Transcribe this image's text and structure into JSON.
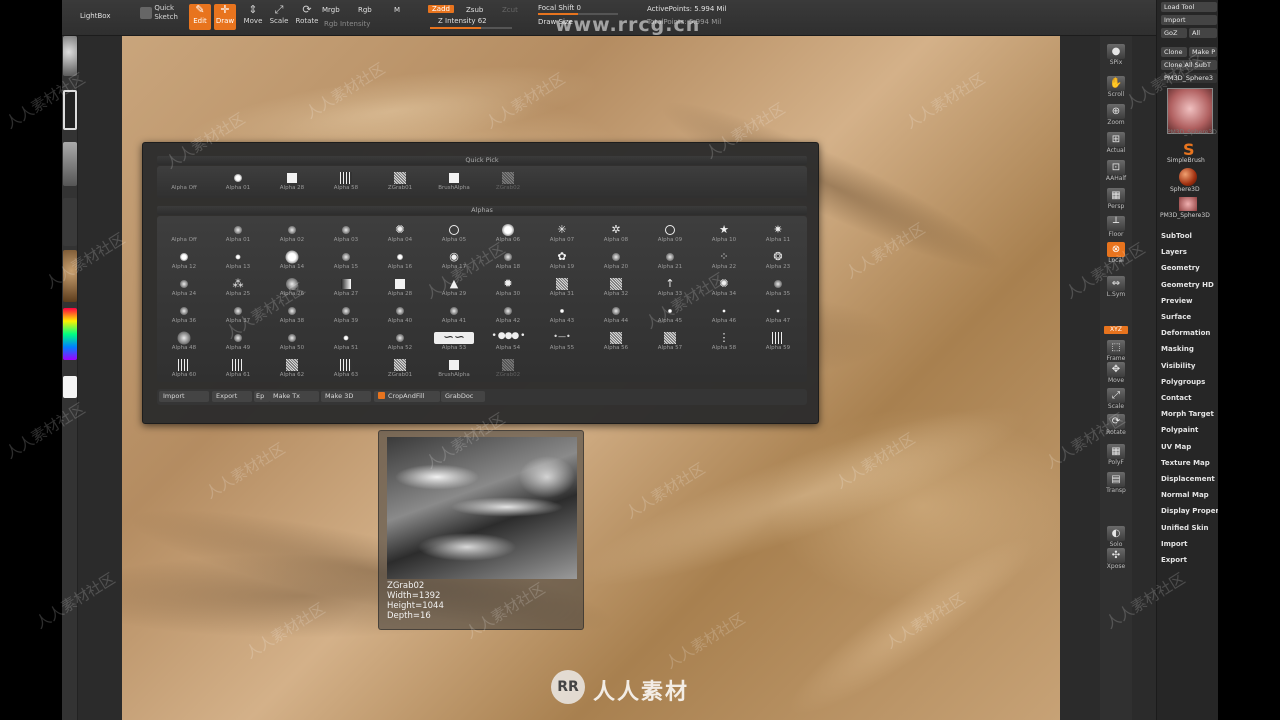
{
  "toolbar": {
    "lightbox": "LightBox",
    "quick_sketch": "Quick\nSketch",
    "edit": "Edit",
    "draw": "Draw",
    "move": "Move",
    "scale": "Scale",
    "rotate": "Rotate",
    "mrgb": "Mrgb",
    "rgb": "Rgb",
    "m": "M",
    "rgb_intensity": "Rgb Intensity",
    "zadd": "Zadd",
    "zsub": "Zsub",
    "zcut": "Zcut",
    "z_intensity": "Z Intensity 62",
    "focal_shift": "Focal Shift 0",
    "draw_size": "Draw Size",
    "active_points": "ActivePoints: 5.994 Mil",
    "total_points": "TotalPoints: 5.994 Mil"
  },
  "right_shelf": [
    "SPix",
    "Scroll",
    "Zoom",
    "Actual",
    "AAHalf",
    "Persp",
    "Floor",
    "Local",
    "L.Sym",
    "Frame",
    "Move",
    "Scale",
    "Rotate",
    "PolyF",
    "Transp",
    "Solo",
    "Xpose"
  ],
  "right_shelf_badge": "XYZ",
  "tool_palette": {
    "buttons": [
      "Load Tool",
      "Import",
      "GoZ",
      "All",
      "Clone",
      "Make P",
      "Clone All SubT",
      "PM3D_Sphere3"
    ],
    "thumb_labels": [
      "PM3D_Sphere3D",
      "SimpleBrush",
      "Sphere3D",
      "PM3D_Sphere3D"
    ],
    "menu": [
      "SubTool",
      "Layers",
      "Geometry",
      "Geometry HD",
      "Preview",
      "Surface",
      "Deformation",
      "Masking",
      "Visibility",
      "Polygroups",
      "Contact",
      "Morph Target",
      "Polypaint",
      "UV Map",
      "Texture Map",
      "Displacement",
      "Normal Map",
      "Display Proper",
      "Unified Skin",
      "Import",
      "Export"
    ]
  },
  "alpha_popup": {
    "quick_pick_title": "Quick Pick",
    "alphas_title": "Alphas",
    "quick_pick": [
      {
        "label": "Alpha Off",
        "kind": "none"
      },
      {
        "label": "Alpha 01",
        "kind": "dot"
      },
      {
        "label": "Alpha 28",
        "kind": "square"
      },
      {
        "label": "Alpha 58",
        "kind": "bars"
      },
      {
        "label": "ZGrab01",
        "kind": "noise"
      },
      {
        "label": "BrushAlpha",
        "kind": "square"
      },
      {
        "label": "ZGrab02",
        "kind": "noise",
        "dim": true
      }
    ],
    "alphas": [
      {
        "label": "Alpha Off",
        "kind": "none"
      },
      {
        "label": "Alpha 01",
        "kind": "soft"
      },
      {
        "label": "Alpha 02",
        "kind": "soft"
      },
      {
        "label": "Alpha 03",
        "kind": "soft"
      },
      {
        "label": "Alpha 04",
        "kind": "glyph",
        "glyph": "✺"
      },
      {
        "label": "Alpha 05",
        "kind": "ring"
      },
      {
        "label": "Alpha 06",
        "kind": "dot",
        "size": 12
      },
      {
        "label": "Alpha 07",
        "kind": "glyph",
        "glyph": "✳"
      },
      {
        "label": "Alpha 08",
        "kind": "glyph",
        "glyph": "✲"
      },
      {
        "label": "Alpha 09",
        "kind": "ring"
      },
      {
        "label": "Alpha 10",
        "kind": "glyph",
        "glyph": "★"
      },
      {
        "label": "Alpha 11",
        "kind": "glyph",
        "glyph": "✷"
      },
      {
        "label": "Alpha 12",
        "kind": "dot"
      },
      {
        "label": "Alpha 13",
        "kind": "dot",
        "size": 5
      },
      {
        "label": "Alpha 14",
        "kind": "dot",
        "size": 13
      },
      {
        "label": "Alpha 15",
        "kind": "soft"
      },
      {
        "label": "Alpha 16",
        "kind": "dot",
        "size": 6
      },
      {
        "label": "Alpha 17",
        "kind": "glyph",
        "glyph": "◉"
      },
      {
        "label": "Alpha 18",
        "kind": "soft"
      },
      {
        "label": "Alpha 19",
        "kind": "glyph",
        "glyph": "✿"
      },
      {
        "label": "Alpha 20",
        "kind": "soft"
      },
      {
        "label": "Alpha 21",
        "kind": "soft"
      },
      {
        "label": "Alpha 22",
        "kind": "glyph",
        "glyph": "⁘"
      },
      {
        "label": "Alpha 23",
        "kind": "glyph",
        "glyph": "❂"
      },
      {
        "label": "Alpha 24",
        "kind": "soft"
      },
      {
        "label": "Alpha 25",
        "kind": "glyph",
        "glyph": "⁂"
      },
      {
        "label": "Alpha 26",
        "kind": "soft",
        "size": 12
      },
      {
        "label": "Alpha 27",
        "kind": "grad"
      },
      {
        "label": "Alpha 28",
        "kind": "square"
      },
      {
        "label": "Alpha 29",
        "kind": "glyph",
        "glyph": "▲"
      },
      {
        "label": "Alpha 30",
        "kind": "glyph",
        "glyph": "✹"
      },
      {
        "label": "Alpha 31",
        "kind": "noise"
      },
      {
        "label": "Alpha 32",
        "kind": "noise"
      },
      {
        "label": "Alpha 33",
        "kind": "glyph",
        "glyph": "↑"
      },
      {
        "label": "Alpha 34",
        "kind": "glyph",
        "glyph": "✺"
      },
      {
        "label": "Alpha 35",
        "kind": "soft"
      },
      {
        "label": "Alpha 36",
        "kind": "soft"
      },
      {
        "label": "Alpha 37",
        "kind": "soft"
      },
      {
        "label": "Alpha 38",
        "kind": "soft"
      },
      {
        "label": "Alpha 39",
        "kind": "soft"
      },
      {
        "label": "Alpha 40",
        "kind": "soft"
      },
      {
        "label": "Alpha 41",
        "kind": "soft"
      },
      {
        "label": "Alpha 42",
        "kind": "soft"
      },
      {
        "label": "Alpha 43",
        "kind": "dot",
        "size": 4
      },
      {
        "label": "Alpha 44",
        "kind": "soft"
      },
      {
        "label": "Alpha 45",
        "kind": "dot",
        "size": 4
      },
      {
        "label": "Alpha 46",
        "kind": "dot",
        "size": 3
      },
      {
        "label": "Alpha 47",
        "kind": "dot",
        "size": 3
      },
      {
        "label": "Alpha 48",
        "kind": "soft",
        "size": 13
      },
      {
        "label": "Alpha 49",
        "kind": "soft"
      },
      {
        "label": "Alpha 50",
        "kind": "soft"
      },
      {
        "label": "Alpha 51",
        "kind": "dot",
        "size": 5
      },
      {
        "label": "Alpha 52",
        "kind": "soft"
      },
      {
        "label": "Alpha 53",
        "kind": "wave"
      },
      {
        "label": "Alpha 54",
        "kind": "beads"
      },
      {
        "label": "Alpha 55",
        "kind": "line"
      },
      {
        "label": "Alpha 56",
        "kind": "noise"
      },
      {
        "label": "Alpha 57",
        "kind": "noise"
      },
      {
        "label": "Alpha 58",
        "kind": "glyph",
        "glyph": "⋮"
      },
      {
        "label": "Alpha 59",
        "kind": "bars"
      },
      {
        "label": "Alpha 60",
        "kind": "bars"
      },
      {
        "label": "Alpha 61",
        "kind": "bars"
      },
      {
        "label": "Alpha 62",
        "kind": "noise"
      },
      {
        "label": "Alpha 63",
        "kind": "bars"
      },
      {
        "label": "ZGrab01",
        "kind": "noise"
      },
      {
        "label": "BrushAlpha",
        "kind": "square"
      },
      {
        "label": "ZGrab02",
        "kind": "noise",
        "dim": true
      }
    ],
    "bottom": {
      "import": "Import",
      "export": "Export",
      "ep": "Ep",
      "make_tx": "Make Tx",
      "make_3d": "Make 3D",
      "crop_and_fill": "CropAndFill",
      "crop_toggle": "Cc",
      "grab_doc": "GrabDoc"
    }
  },
  "preview": {
    "info": "ZGrab02\nWidth=1392\nHeight=1044\nDepth=16"
  },
  "watermark": {
    "url": "www.rrcg.cn",
    "logo_text": "人人素材",
    "badge": "RR",
    "tile": "人人素材社区"
  },
  "colors": {
    "accent": "#e8741e",
    "panel": "#2b2b2b",
    "canvas": "#c4a073"
  }
}
